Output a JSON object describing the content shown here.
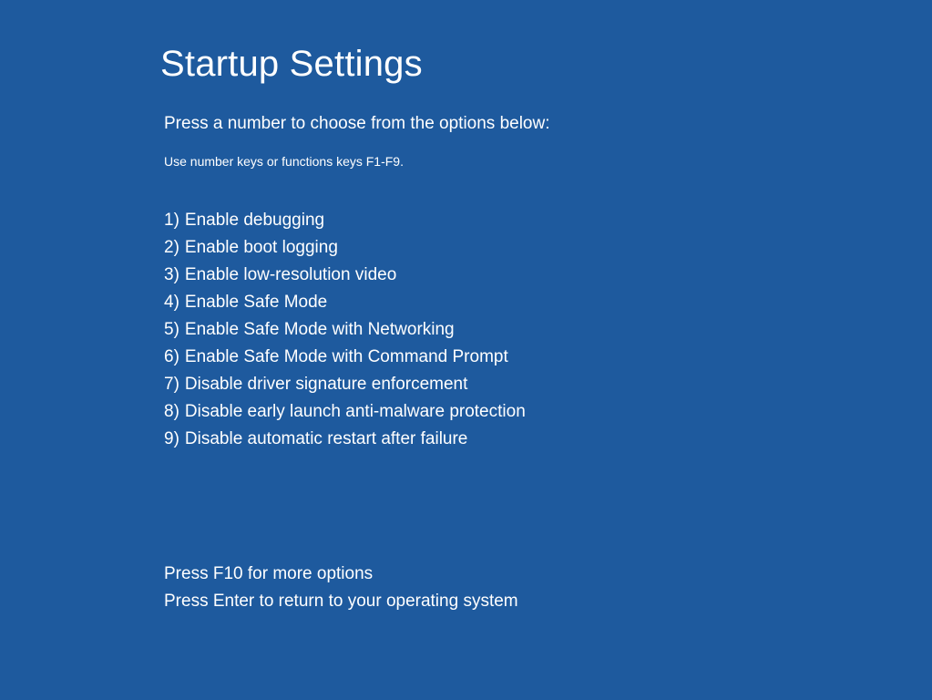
{
  "title": "Startup Settings",
  "instruction": "Press a number to choose from the options below:",
  "hint": "Use number keys or functions keys F1-F9.",
  "options": [
    {
      "num": "1)",
      "label": "Enable debugging"
    },
    {
      "num": "2)",
      "label": "Enable boot logging"
    },
    {
      "num": "3)",
      "label": "Enable low-resolution video"
    },
    {
      "num": "4)",
      "label": "Enable Safe Mode"
    },
    {
      "num": "5)",
      "label": "Enable Safe Mode with Networking"
    },
    {
      "num": "6)",
      "label": "Enable Safe Mode with Command Prompt"
    },
    {
      "num": "7)",
      "label": "Disable driver signature enforcement"
    },
    {
      "num": "8)",
      "label": "Disable early launch anti-malware protection"
    },
    {
      "num": "9)",
      "label": "Disable automatic restart after failure"
    }
  ],
  "footer": {
    "more_options": "Press F10 for more options",
    "return": "Press Enter to return to your operating system"
  }
}
